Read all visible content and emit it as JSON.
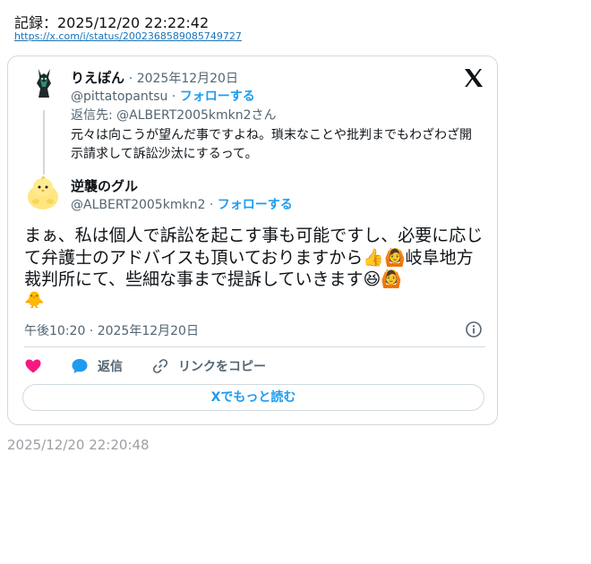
{
  "record": {
    "label": "記録：2025/12/20 22:22:42",
    "url": "https://x.com/i/status/2002368589085749727"
  },
  "quoted_tweet": {
    "name": "りえぽん",
    "sep_date": "· 2025年12月20日",
    "handle": "@pittatopantsu",
    "follow": "フォローする",
    "reply_to": "返信先: @ALBERT2005kmkn2さん",
    "text": "元々は向こうが望んだ事ですよね。瑣末なことや批判までもわざわざ開示請求して訴訟沙汰にするって。"
  },
  "main_tweet": {
    "name": "逆襲のグル",
    "handle": "@ALBERT2005kmkn2",
    "follow": "フォローする",
    "text": "まぁ、私は個人で訴訟を起こす事も可能ですし、必要に応じて弁護士のアドバイスも頂いておりますから👍🙆岐阜地方裁判所にて、些細な事まで提訴していきます😆🙆",
    "trailing_emoji": "🐥",
    "timestamp": "午後10:20 · 2025年12月20日"
  },
  "actions": {
    "reply": "返信",
    "copy_link": "リンクをコピー",
    "read_more": "Xでもっと読む"
  },
  "footer_timestamp": "2025/12/20 22:20:48",
  "icons": [
    "x-logo-icon",
    "heart-icon",
    "reply-bubble-icon",
    "link-icon",
    "info-icon"
  ],
  "colors": {
    "accent": "#1d9bf0",
    "heart": "#f91880",
    "muted": "#536471"
  }
}
